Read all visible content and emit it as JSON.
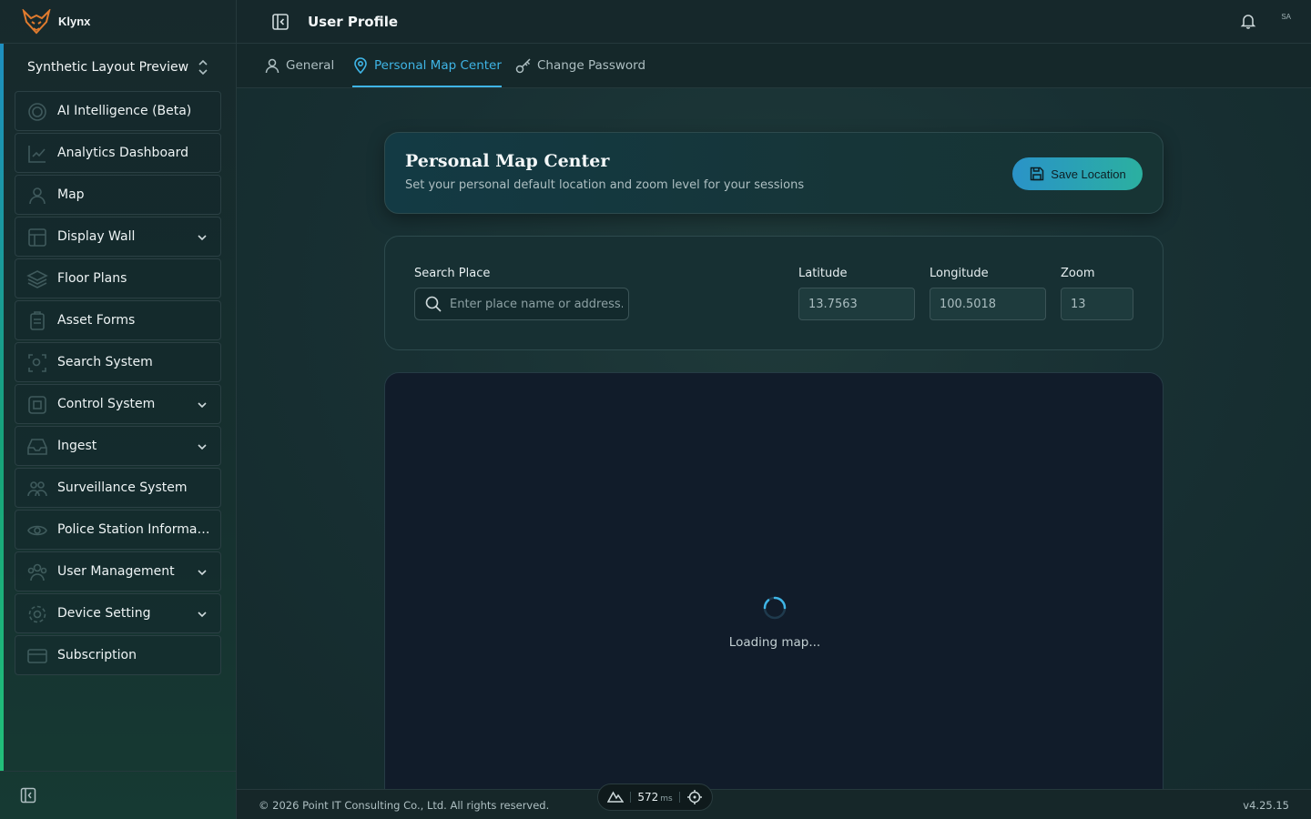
{
  "app": {
    "brand": "Klynx",
    "workspace": "Synthetic Layout Preview"
  },
  "sidebar": {
    "items": [
      {
        "label": "AI Intelligence (Beta)",
        "icon": "ai-icon",
        "has_children": false
      },
      {
        "label": "Analytics Dashboard",
        "icon": "analytics-icon",
        "has_children": false
      },
      {
        "label": "Map",
        "icon": "map-user-icon",
        "has_children": false
      },
      {
        "label": "Display Wall",
        "icon": "display-wall-icon",
        "has_children": true
      },
      {
        "label": "Floor Plans",
        "icon": "layers-icon",
        "has_children": false
      },
      {
        "label": "Asset Forms",
        "icon": "clipboard-icon",
        "has_children": false
      },
      {
        "label": "Search System",
        "icon": "scan-search-icon",
        "has_children": false
      },
      {
        "label": "Control System",
        "icon": "control-icon",
        "has_children": true
      },
      {
        "label": "Ingest",
        "icon": "inbox-icon",
        "has_children": true
      },
      {
        "label": "Surveillance System",
        "icon": "people-icon",
        "has_children": false
      },
      {
        "label": "Police Station Information",
        "icon": "eye-icon",
        "has_children": false
      },
      {
        "label": "User Management",
        "icon": "users-icon",
        "has_children": true
      },
      {
        "label": "Device Setting",
        "icon": "gear-icon",
        "has_children": true
      },
      {
        "label": "Subscription",
        "icon": "card-icon",
        "has_children": false
      }
    ]
  },
  "header": {
    "title": "User Profile",
    "avatar_initials": "SA"
  },
  "tabs": [
    {
      "label": "General",
      "icon": "user-icon",
      "active": false
    },
    {
      "label": "Personal Map Center",
      "icon": "map-pin-icon",
      "active": true
    },
    {
      "label": "Change Password",
      "icon": "key-icon",
      "active": false
    }
  ],
  "map_center": {
    "title": "Personal Map Center",
    "subtitle": "Set your personal default location and zoom level for your sessions",
    "save_label": "Save Location",
    "search_label": "Search Place",
    "search_placeholder": "Enter place name or address...",
    "latitude_label": "Latitude",
    "latitude_value": "13.7563",
    "longitude_label": "Longitude",
    "longitude_value": "100.5018",
    "zoom_label": "Zoom",
    "zoom_value": "13",
    "loading_text": "Loading map..."
  },
  "footer": {
    "copyright": "© 2026 Point IT Consulting Co., Ltd. All rights reserved.",
    "version": "v4.25.15",
    "perf_ms": "572",
    "perf_unit": "ms"
  },
  "colors": {
    "accent": "#3fb5e6",
    "save_gradient_start": "#2a93c8",
    "save_gradient_end": "#2bb0a0",
    "brand_orange": "#e07b2e"
  }
}
